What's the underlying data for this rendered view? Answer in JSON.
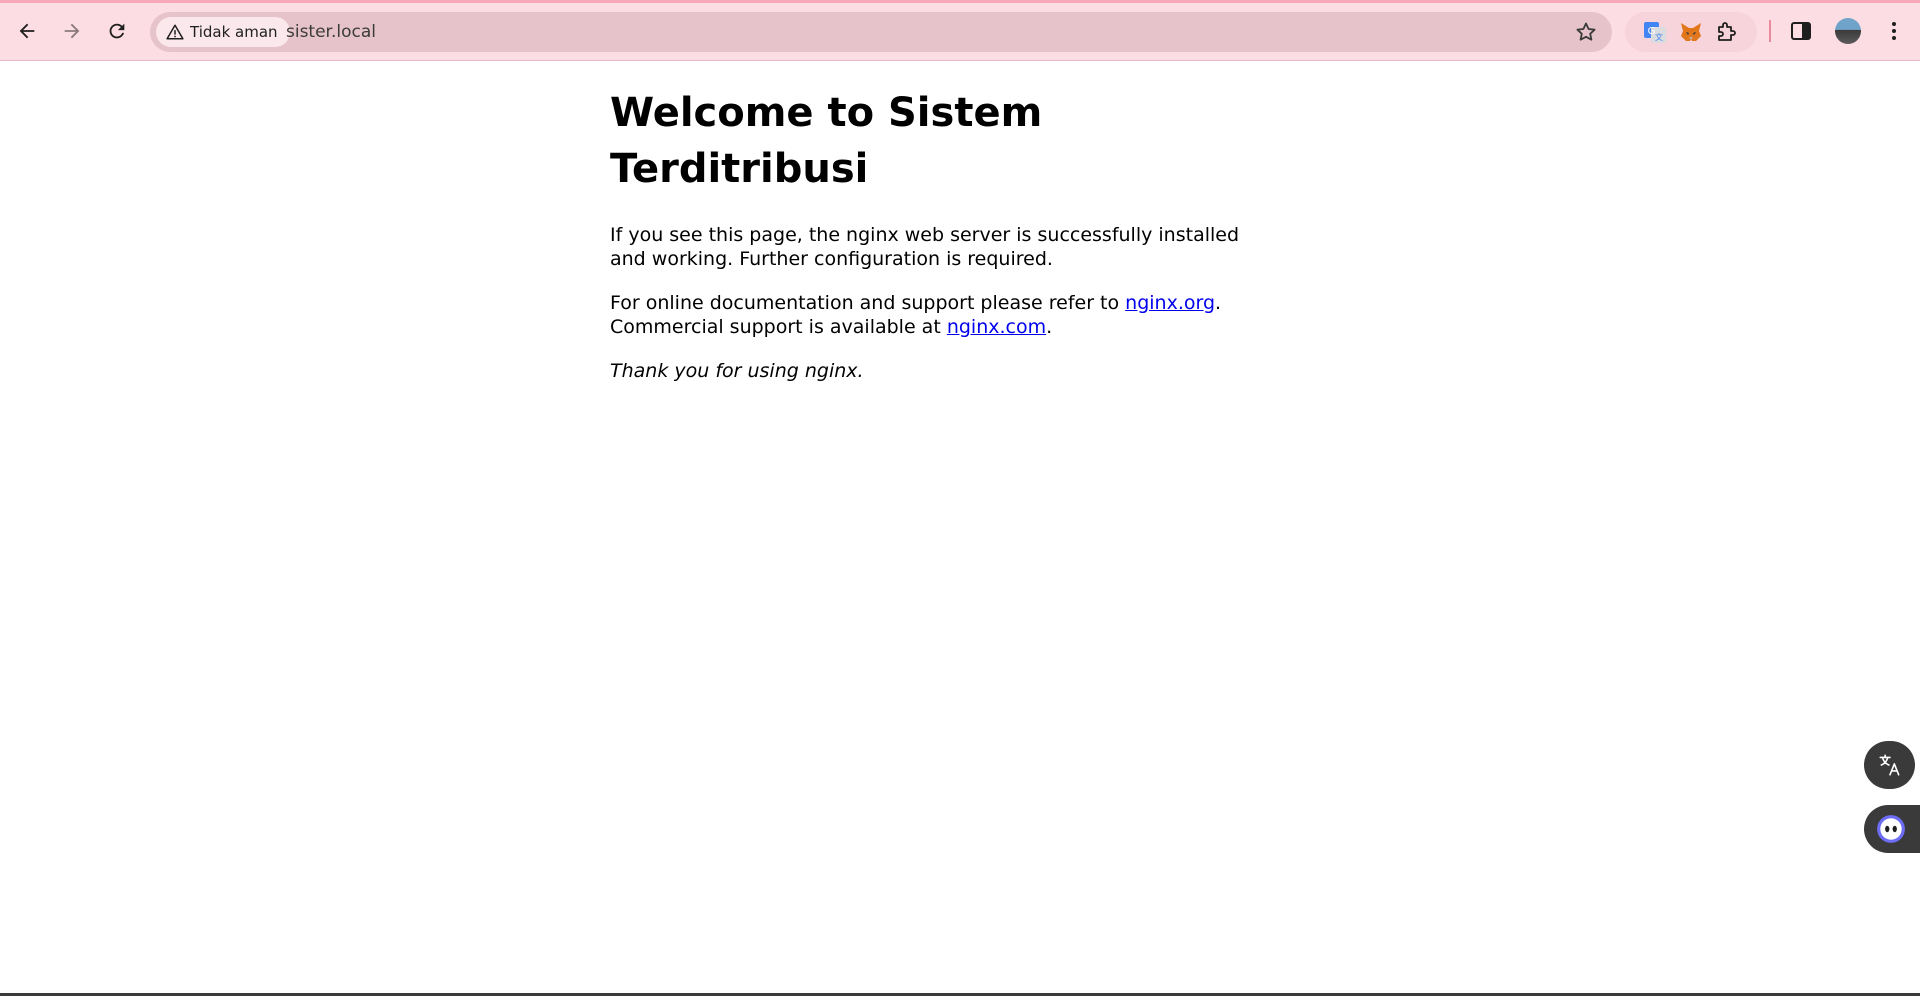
{
  "browser": {
    "security_label": "Tidak aman",
    "url": "sister.local",
    "icons": {
      "back": "arrow-left-icon",
      "forward": "arrow-right-icon",
      "reload": "reload-icon",
      "warning": "warning-triangle-icon",
      "bookmark": "star-icon",
      "translate_ext": "google-translate-icon",
      "metamask_ext": "fox-icon",
      "extensions": "puzzle-icon",
      "side_panel": "side-panel-icon",
      "menu": "kebab-menu-icon"
    },
    "colors": {
      "toolbar_bg": "#fddde4",
      "omnibox_bg": "#e6c3cb"
    }
  },
  "page": {
    "heading": "Welcome to Sistem Terditribusi",
    "para1": "If you see this page, the nginx web server is successfully installed and working. Further configuration is required.",
    "para2_prefix": "For online documentation and support please refer to ",
    "link_org": "nginx.org",
    "para2_mid": ".",
    "para2_line2_prefix": "Commercial support is available at ",
    "link_com": "nginx.com",
    "para2_suffix": ".",
    "thanks": "Thank you for using nginx.",
    "link_color": "#0000ee"
  },
  "floating": {
    "translate_icon": "translate-icon",
    "assistant_icon": "bot-face-icon"
  }
}
